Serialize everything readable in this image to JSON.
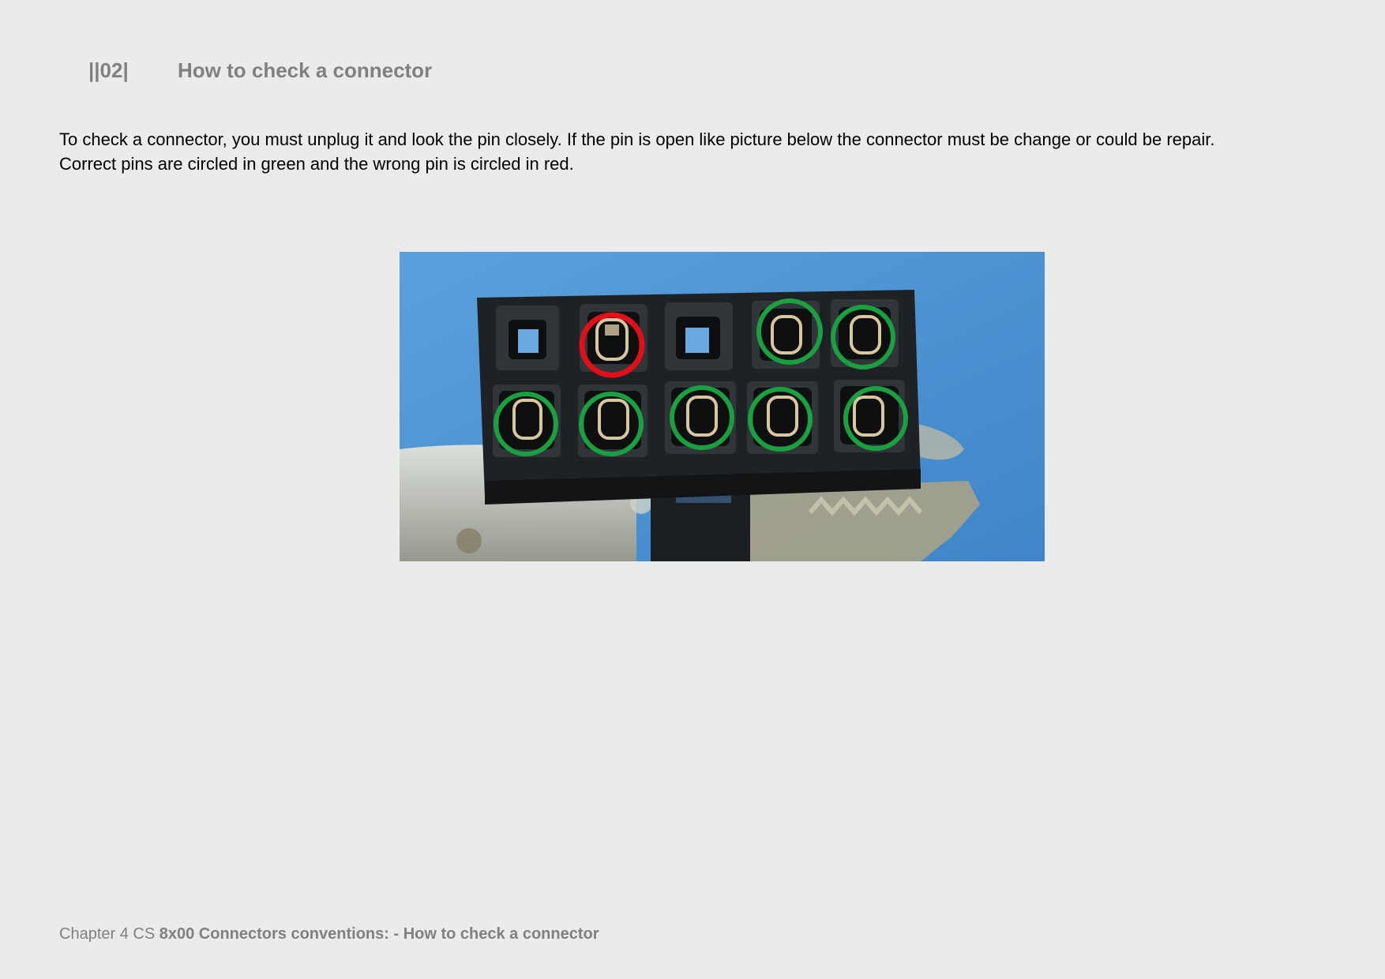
{
  "header": {
    "section_number": "||02|",
    "section_title": "How to check a connector"
  },
  "body": {
    "paragraph_line_1": "To check a connector, you must unplug it and look the pin closely. If the pin is open like picture below the connector must be change or could be repair.",
    "paragraph_line_2": "Correct pins are circled in green and the wrong pin is circled in red."
  },
  "figure": {
    "colors": {
      "correct_circle": "#1aa040",
      "wrong_circle": "#e0101a",
      "background": "#4a94d3",
      "connector_body": "#1e2226"
    },
    "pins": {
      "top_row": [
        "empty",
        "wrong",
        "empty",
        "correct",
        "correct"
      ],
      "bottom_row": [
        "correct",
        "correct",
        "correct",
        "correct",
        "correct"
      ]
    }
  },
  "footer": {
    "prefix": "Chapter 4 CS ",
    "bold_text": "8x00 Connectors conventions: - How to check a connector"
  }
}
